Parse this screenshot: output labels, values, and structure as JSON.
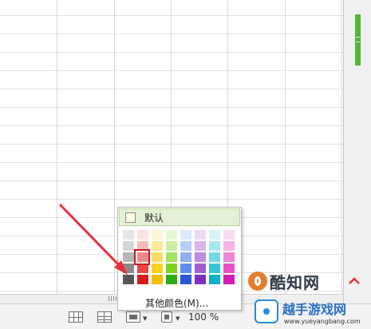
{
  "color_dropdown": {
    "default_label": "默认",
    "more_colors_label": "其他颜色(M)...",
    "palette_columns": [
      [
        "#e6e6e6",
        "#d5d5d5",
        "#b7b7b7",
        "#8a8a8a",
        "#565656"
      ],
      [
        "#fbe1e1",
        "#f6b9b9",
        "#f08a8a",
        "#e84646",
        "#d61a1a"
      ],
      [
        "#fdf5d4",
        "#fbe99c",
        "#f9dd60",
        "#f8d21d",
        "#f2c000"
      ],
      [
        "#e6f7d4",
        "#c8ef9c",
        "#a5e35d",
        "#7ed321",
        "#2eac0d"
      ],
      [
        "#dbe9fb",
        "#b6cff6",
        "#8db0f0",
        "#5b8eea",
        "#2b56d8"
      ],
      [
        "#efdaf6",
        "#d9b3ec",
        "#c08ae0",
        "#a35dd2",
        "#7d2fbe"
      ],
      [
        "#d6f3f6",
        "#aae6ee",
        "#74d8e4",
        "#35c6d8",
        "#0bb1c6"
      ],
      [
        "#fadcf2",
        "#f5b4e6",
        "#ef86d6",
        "#e851c4",
        "#d21db0"
      ]
    ],
    "selected_color": "#d61a1a"
  },
  "statusbar": {
    "zoom_label": "100 %"
  },
  "watermarks": {
    "logo_text": "酷知网",
    "site_title": "越手游戏网",
    "site_url": "www.yueyangbang.com"
  },
  "accent_color": "#56b33d"
}
